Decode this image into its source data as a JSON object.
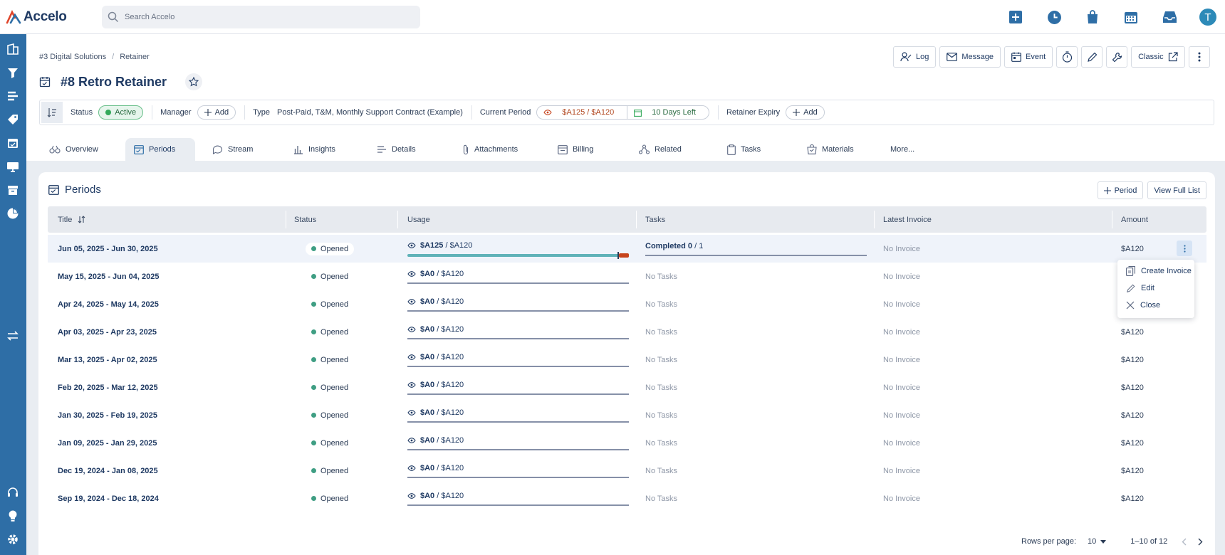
{
  "app": {
    "logo_text": "Accelo"
  },
  "search": {
    "placeholder": "Search Accelo"
  },
  "top_icons": [
    "plus-square-icon",
    "clock-icon",
    "bag-icon",
    "calendar-icon",
    "inbox-icon"
  ],
  "user": {
    "initial": "T"
  },
  "breadcrumb": [
    "#3 Digital Solutions",
    "Retainer"
  ],
  "page": {
    "title": "#8 Retro Retainer"
  },
  "actions": {
    "log": "Log",
    "message": "Message",
    "event": "Event",
    "classic": "Classic"
  },
  "statusbar": {
    "status_label": "Status",
    "status_value": "Active",
    "manager_label": "Manager",
    "manager_add": "Add",
    "type_label": "Type",
    "type_value": "Post-Paid, T&M, Monthly Support Contract (Example)",
    "period_label": "Current Period",
    "period_usage": "$A125 / $A120",
    "period_left": "10 Days Left",
    "expiry_label": "Retainer Expiry",
    "expiry_add": "Add"
  },
  "tabs": [
    {
      "label": "Overview"
    },
    {
      "label": "Periods"
    },
    {
      "label": "Stream"
    },
    {
      "label": "Insights"
    },
    {
      "label": "Details"
    },
    {
      "label": "Attachments"
    },
    {
      "label": "Billing"
    },
    {
      "label": "Related"
    },
    {
      "label": "Tasks"
    },
    {
      "label": "Materials"
    },
    {
      "label": "More..."
    }
  ],
  "periods": {
    "title": "Periods",
    "add_period": "Period",
    "view_full": "View Full List",
    "columns": [
      "Title",
      "Status",
      "Usage",
      "Tasks",
      "Latest Invoice",
      "Amount"
    ],
    "rows": [
      {
        "title": "Jun 05, 2025 - Jun 30, 2025",
        "status": "Opened",
        "used": "$A125",
        "budget": "$A120",
        "tasks_label": "Completed",
        "tasks_done": "0",
        "tasks_total": "1",
        "invoice": "No Invoice",
        "amount": "$A120"
      },
      {
        "title": "May 15, 2025 - Jun 04, 2025",
        "status": "Opened",
        "used": "$A0",
        "budget": "$A120",
        "tasks": "No Tasks",
        "invoice": "No Invoice",
        "amount": ""
      },
      {
        "title": "Apr 24, 2025 - May 14, 2025",
        "status": "Opened",
        "used": "$A0",
        "budget": "$A120",
        "tasks": "No Tasks",
        "invoice": "No Invoice",
        "amount": ""
      },
      {
        "title": "Apr 03, 2025 - Apr 23, 2025",
        "status": "Opened",
        "used": "$A0",
        "budget": "$A120",
        "tasks": "No Tasks",
        "invoice": "No Invoice",
        "amount": "$A120"
      },
      {
        "title": "Mar 13, 2025 - Apr 02, 2025",
        "status": "Opened",
        "used": "$A0",
        "budget": "$A120",
        "tasks": "No Tasks",
        "invoice": "No Invoice",
        "amount": "$A120"
      },
      {
        "title": "Feb 20, 2025 - Mar 12, 2025",
        "status": "Opened",
        "used": "$A0",
        "budget": "$A120",
        "tasks": "No Tasks",
        "invoice": "No Invoice",
        "amount": "$A120"
      },
      {
        "title": "Jan 30, 2025 - Feb 19, 2025",
        "status": "Opened",
        "used": "$A0",
        "budget": "$A120",
        "tasks": "No Tasks",
        "invoice": "No Invoice",
        "amount": "$A120"
      },
      {
        "title": "Jan 09, 2025 - Jan 29, 2025",
        "status": "Opened",
        "used": "$A0",
        "budget": "$A120",
        "tasks": "No Tasks",
        "invoice": "No Invoice",
        "amount": "$A120"
      },
      {
        "title": "Dec 19, 2024 - Jan 08, 2025",
        "status": "Opened",
        "used": "$A0",
        "budget": "$A120",
        "tasks": "No Tasks",
        "invoice": "No Invoice",
        "amount": "$A120"
      },
      {
        "title": "Sep 19, 2024 - Dec 18, 2024",
        "status": "Opened",
        "used": "$A0",
        "budget": "$A120",
        "tasks": "No Tasks",
        "invoice": "No Invoice",
        "amount": "$A120"
      }
    ]
  },
  "row_menu": {
    "create_invoice": "Create Invoice",
    "edit": "Edit",
    "close": "Close"
  },
  "pagination": {
    "rows_per_page_label": "Rows per page:",
    "rows_per_page": "10",
    "range": "1–10 of 12"
  }
}
